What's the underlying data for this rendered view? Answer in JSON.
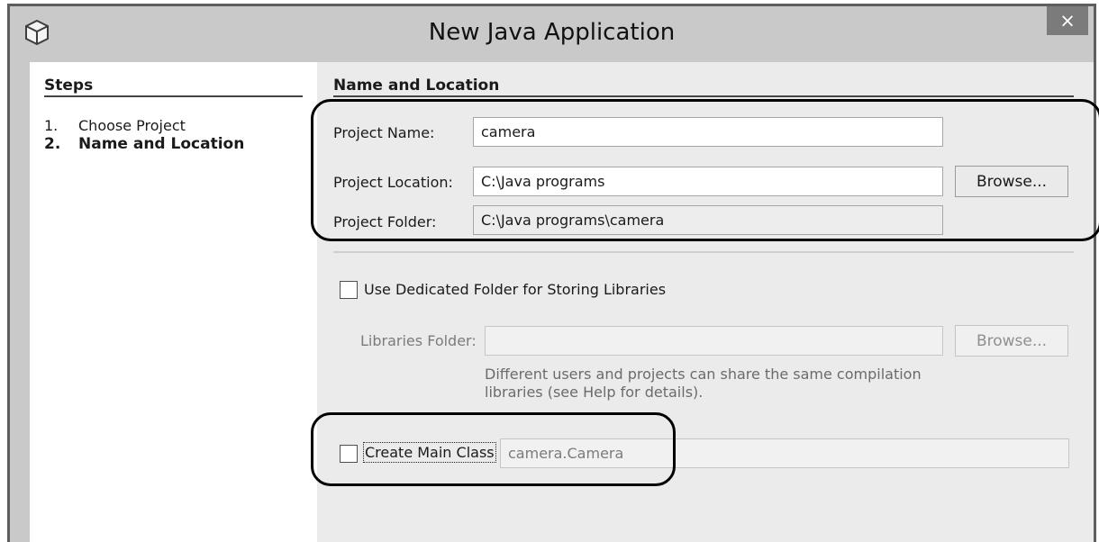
{
  "window": {
    "title": "New Java Application",
    "close_label": "×",
    "app_icon": "cube-icon"
  },
  "steps": {
    "heading": "Steps",
    "items": [
      {
        "num": "1.",
        "label": "Choose Project",
        "current": false
      },
      {
        "num": "2.",
        "label": "Name and Location",
        "current": true
      }
    ]
  },
  "panel": {
    "heading": "Name and Location",
    "project_name": {
      "label": "Project Name:",
      "value": "camera"
    },
    "project_location": {
      "label": "Project Location:",
      "value": "C:\\Java programs",
      "browse_label": "Browse..."
    },
    "project_folder": {
      "label": "Project Folder:",
      "value": "C:\\Java programs\\camera"
    },
    "dedicated_folder": {
      "label": "Use Dedicated Folder for Storing Libraries",
      "checked": false
    },
    "libraries_folder": {
      "label": "Libraries Folder:",
      "value": "",
      "browse_label": "Browse..."
    },
    "libraries_hint": [
      "Different users and projects can share the same compilation",
      "libraries (see Help for details)."
    ],
    "main_class": {
      "label": "Create Main Class",
      "value": "camera.Camera",
      "checked": false
    }
  }
}
